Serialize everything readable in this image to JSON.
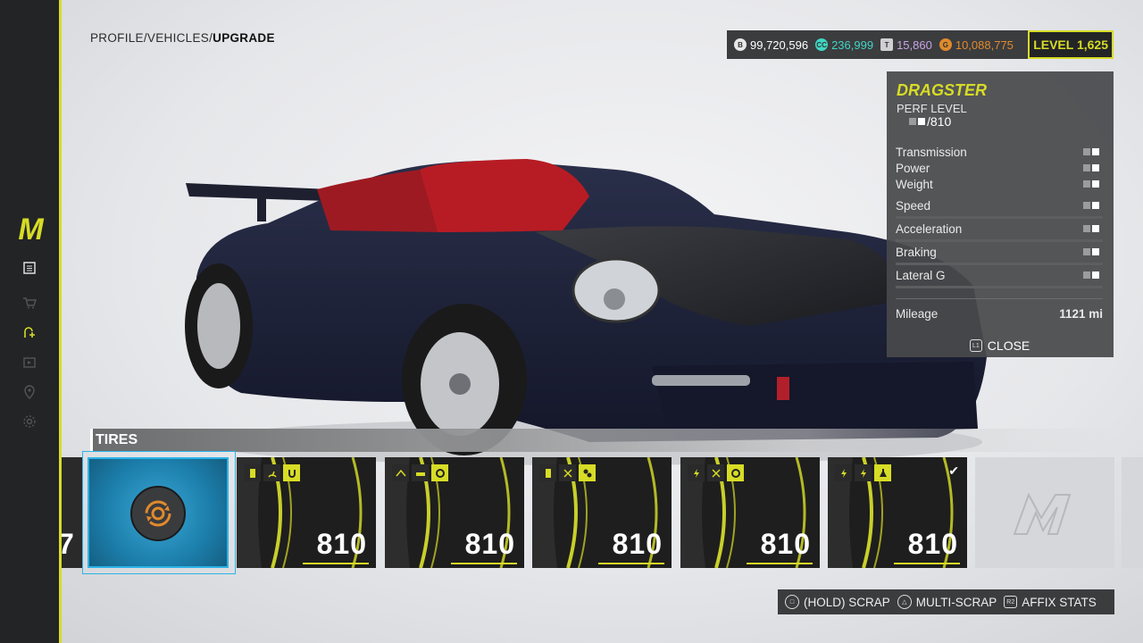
{
  "breadcrumb": {
    "path": "PROFILE/VEHICLES/",
    "current": "UPGRADE"
  },
  "currency": {
    "bank": "99,720,596",
    "cc": "236,999",
    "tokens": "15,860",
    "gold": "10,088,775",
    "level": "LEVEL 1,625"
  },
  "brand": {
    "logo": "M",
    "accent": "#d7dc25"
  },
  "info_panel": {
    "car_name": "DRAGSTER",
    "perf_label": "PERF LEVEL",
    "perf_value": "/810",
    "stats": [
      {
        "label": "Transmission"
      },
      {
        "label": "Power"
      },
      {
        "label": "Weight"
      },
      {
        "label": "Speed"
      },
      {
        "label": "Acceleration"
      },
      {
        "label": "Braking"
      },
      {
        "label": "Lateral G"
      }
    ],
    "mileage_label": "Mileage",
    "mileage_value": "1121 mi",
    "close_key": "L1",
    "close_label": "CLOSE"
  },
  "tires": {
    "label": "TIRES",
    "partial_value": "7",
    "cards": [
      {
        "value": "810",
        "icons": [
          "fuel-icon",
          "gauge-icon",
          "magnet-icon"
        ]
      },
      {
        "value": "810",
        "icons": [
          "speed-icon",
          "car-icon",
          "turbo-icon"
        ]
      },
      {
        "value": "810",
        "icons": [
          "fuel-icon",
          "xp-icon",
          "gears-icon"
        ]
      },
      {
        "value": "810",
        "icons": [
          "bolt-icon",
          "xp-icon",
          "turbo-icon"
        ]
      },
      {
        "value": "810",
        "icons": [
          "bolt-icon",
          "bolt-icon",
          "flask-icon"
        ],
        "equipped": true
      }
    ]
  },
  "actions": {
    "scrap": "(HOLD) SCRAP",
    "multi_scrap": "MULTI-SCRAP",
    "affix_key": "R2",
    "affix": "AFFIX STATS"
  }
}
